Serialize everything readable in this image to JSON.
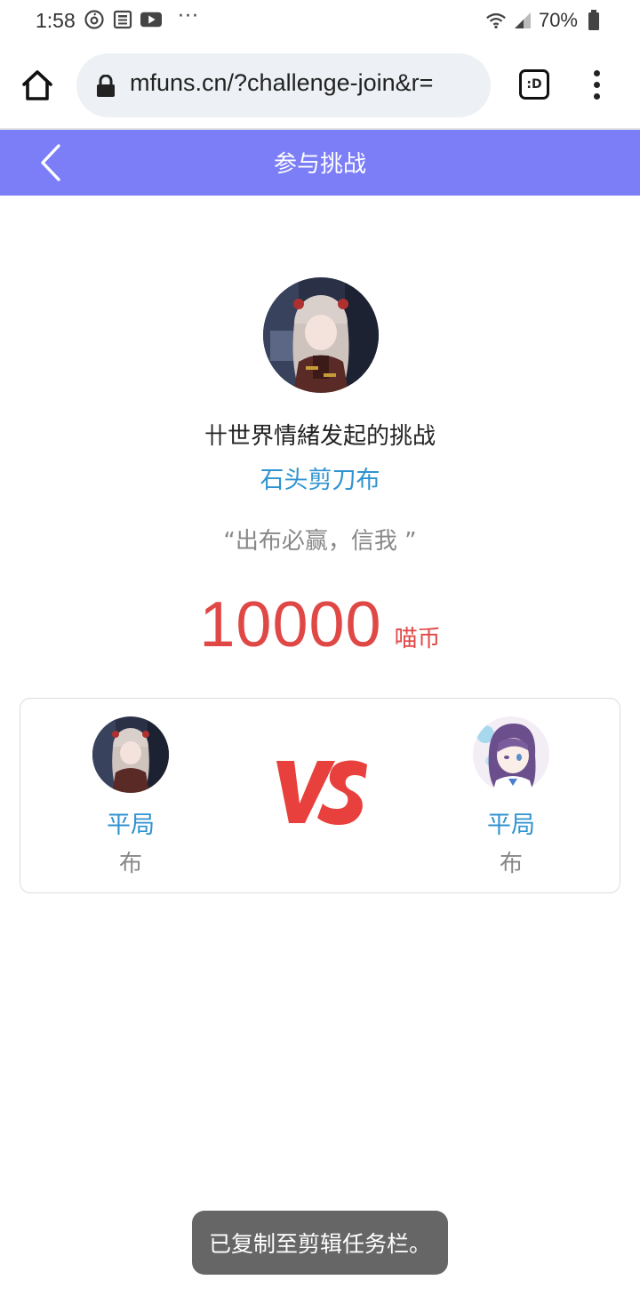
{
  "status_bar": {
    "time": "1:58",
    "more": "···",
    "battery_percent": "70%",
    "icons": [
      "netease-music-icon",
      "news-icon",
      "youtube-icon",
      "wifi-icon",
      "signal-icon",
      "battery-icon"
    ]
  },
  "browser": {
    "url": "mfuns.cn/?challenge-join&r=",
    "tab_label": ":D"
  },
  "header": {
    "title": "参与挑战",
    "color": "#7b7ef7"
  },
  "challenge": {
    "challenger_line": "卄世界情緒发起的挑战",
    "game_name": "石头剪刀布",
    "quote": "“出布必赢，信我 ”",
    "amount": "10000",
    "unit": "喵币"
  },
  "versus": {
    "left": {
      "result": "平局",
      "choice": "布"
    },
    "right": {
      "result": "平局",
      "choice": "布"
    },
    "vs_label": "VS",
    "vs_color": "#e8403c"
  },
  "toast": {
    "message": "已复制至剪辑任务栏。"
  }
}
